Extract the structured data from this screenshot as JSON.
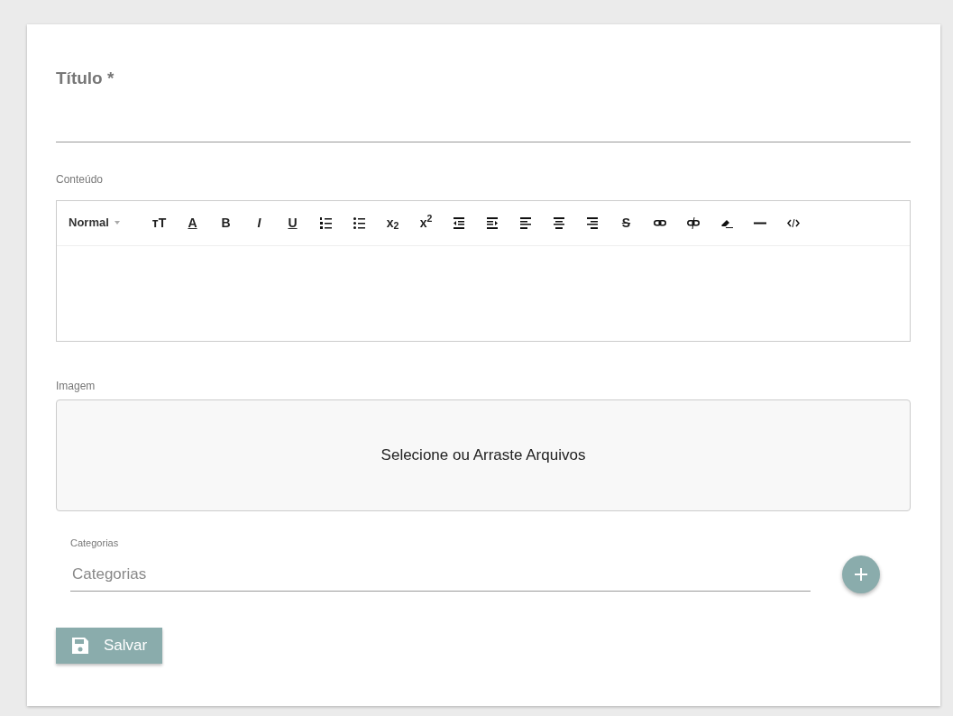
{
  "title_field": {
    "label": "Título *"
  },
  "content": {
    "label": "Conteúdo",
    "format": "Normal",
    "toolbar": [
      {
        "kind": "size",
        "label": "тT"
      },
      {
        "kind": "color",
        "label": "A"
      },
      {
        "kind": "bold",
        "label": "B"
      },
      {
        "kind": "italic",
        "label": "I"
      },
      {
        "kind": "underline",
        "label": "U"
      },
      {
        "kind": "ordered-list"
      },
      {
        "kind": "bullet-list"
      },
      {
        "kind": "subscript",
        "label": "x$_{2}$"
      },
      {
        "kind": "superscript",
        "label": "x$^{2}$"
      },
      {
        "kind": "outdent"
      },
      {
        "kind": "indent"
      },
      {
        "kind": "align-left"
      },
      {
        "kind": "align-center"
      },
      {
        "kind": "align-right"
      },
      {
        "kind": "strike",
        "label": "S"
      },
      {
        "kind": "link"
      },
      {
        "kind": "unlink"
      },
      {
        "kind": "eraser"
      },
      {
        "kind": "rule"
      },
      {
        "kind": "code"
      }
    ]
  },
  "image": {
    "label": "Imagem",
    "dropzone": "Selecione ou Arraste Arquivos"
  },
  "categories": {
    "label": "Categorias",
    "placeholder": "Categorias"
  },
  "save_button": "Salvar"
}
